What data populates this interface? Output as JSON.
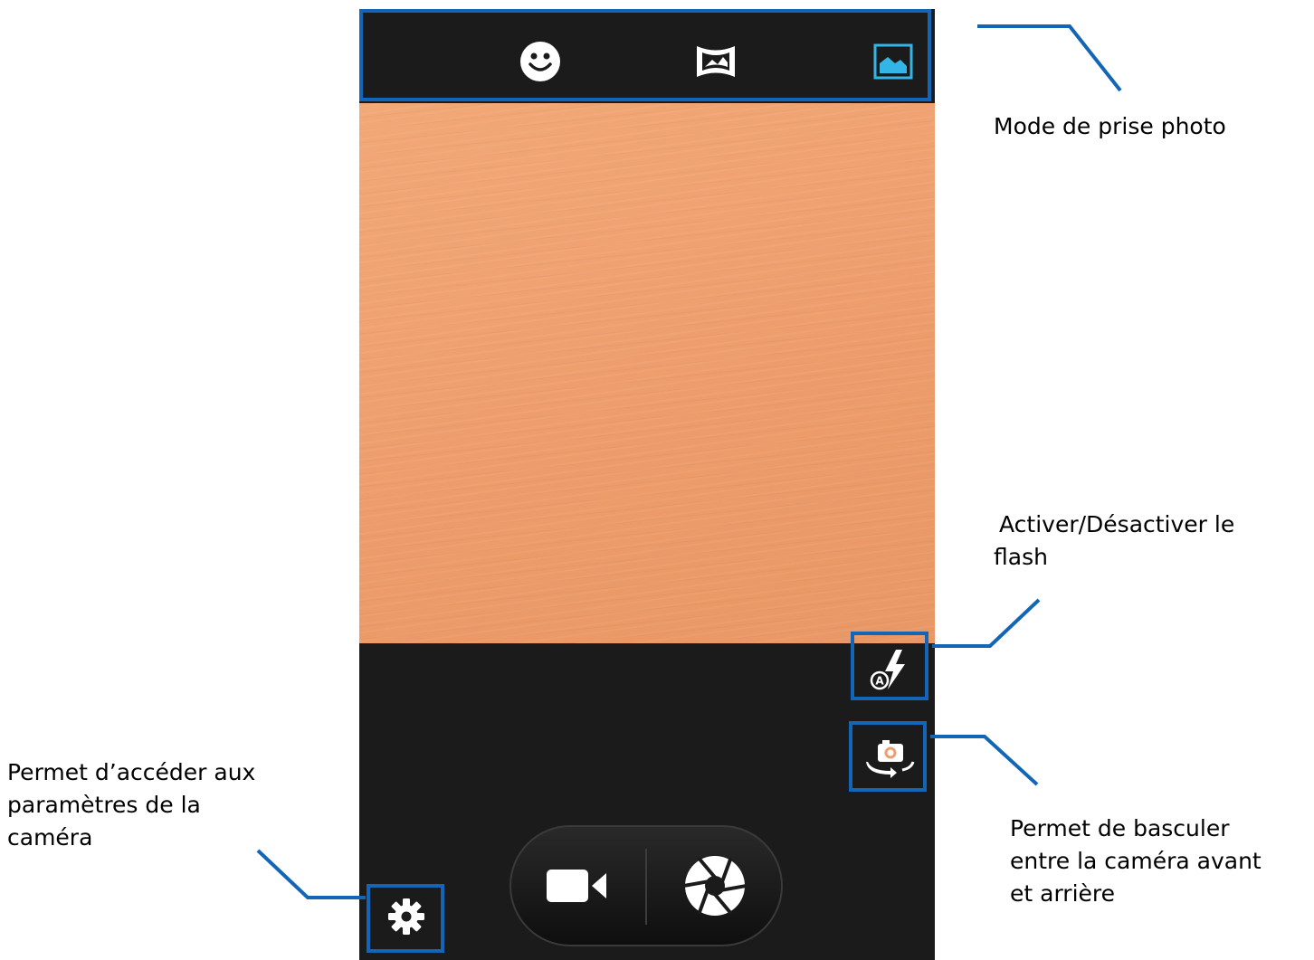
{
  "annotations": {
    "mode": "Mode de prise photo",
    "flash_line1": "Activer/Désactiver le",
    "flash_line2": "flash",
    "switch_line1": "Permet de basculer",
    "switch_line2": "entre la caméra avant",
    "switch_line3": "et arrière",
    "settings_line1": "Permet d’accéder aux",
    "settings_line2": "paramètres de la",
    "settings_line3": "caméra"
  },
  "shooting_modes": [
    {
      "icon": "face-icon",
      "selected": false
    },
    {
      "icon": "panorama-icon",
      "selected": false
    },
    {
      "icon": "landscape-icon",
      "selected": true
    }
  ],
  "flash": {
    "icon": "flash-auto-icon",
    "mode_letter": "A"
  },
  "camera_switch": {
    "icon": "switch-camera-icon"
  },
  "settings": {
    "icon": "gear-icon"
  },
  "capture": {
    "video_icon": "video-camera-icon",
    "shutter_icon": "shutter-icon"
  },
  "colors": {
    "highlight": "#1366b7",
    "bar": "#1b1b1b",
    "selected_mode": "#33b5e5",
    "viewfinder": "#f0a370"
  }
}
